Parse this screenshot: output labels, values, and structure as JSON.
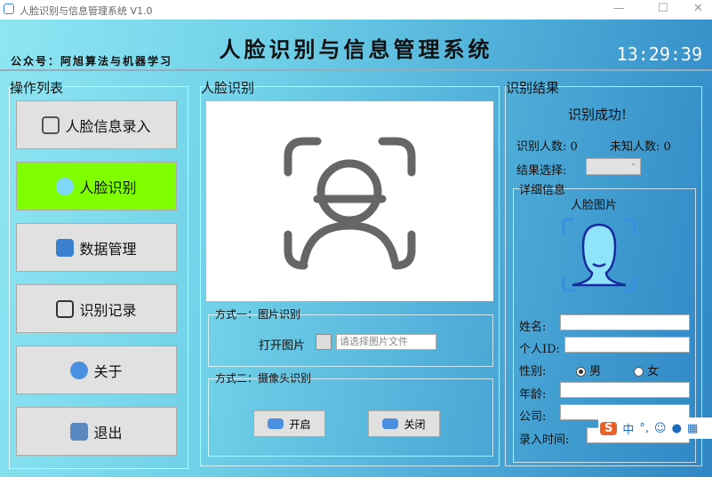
{
  "window": {
    "title": "人脸识别与信息管理系统 V1.0"
  },
  "header": {
    "title": "人脸识别与信息管理系统",
    "subtitle": "公众号：阿旭算法与机器学习",
    "clock": "13:29:39"
  },
  "nav": {
    "title": "操作列表",
    "items": [
      {
        "label": "人脸信息录入"
      },
      {
        "label": "人脸识别"
      },
      {
        "label": "数据管理"
      },
      {
        "label": "识别记录"
      },
      {
        "label": "关于"
      },
      {
        "label": "退出"
      }
    ]
  },
  "center": {
    "title": "人脸识别",
    "method1": {
      "title": "方式一：图片识别",
      "open_label": "打开图片",
      "placeholder": "请选择图片文件"
    },
    "method2": {
      "title": "方式二：摄像头识别",
      "start": "开启",
      "stop": "关闭"
    }
  },
  "result": {
    "title": "识别结果",
    "status": "识别成功!",
    "recognized_label": "识别人数:",
    "recognized": "0",
    "unknown_label": "未知人数:",
    "unknown": "0",
    "select_label": "结果选择:",
    "detail": {
      "title": "详细信息",
      "face_label": "人脸图片",
      "name": "姓名:",
      "id": "个人ID:",
      "gender": "性别:",
      "male": "男",
      "female": "女",
      "age": "年龄:",
      "company": "公司:",
      "time": "录入时间:"
    }
  },
  "ime": {
    "logo": "S",
    "mode": "中",
    "punct": "°,"
  }
}
